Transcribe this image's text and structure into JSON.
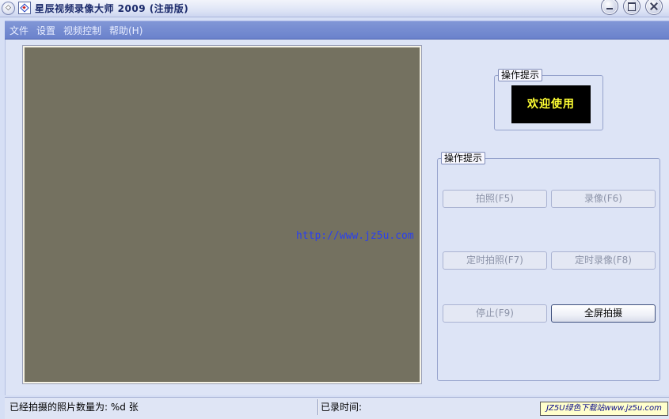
{
  "window": {
    "title": "星辰视频录像大师 2009 (注册版)"
  },
  "menu": {
    "items": [
      "文件",
      "设置",
      "视频控制",
      "帮助(H)"
    ]
  },
  "tips_panel": {
    "legend": "操作提示",
    "message": "欢迎使用"
  },
  "controls_panel": {
    "legend": "操作提示",
    "buttons": {
      "photo": "拍照(F5)",
      "record": "录像(F6)",
      "timed_photo": "定时拍照(F7)",
      "timed_record": "定时录像(F8)",
      "stop": "停止(F9)",
      "fullscreen": "全屏拍摄"
    }
  },
  "watermark": "http://www.jz5u.com",
  "status": {
    "photo_count": "已经拍摄的照片数量为: %d 张",
    "record_time": "已录时间:"
  },
  "badge": "JZ5U绿色下载站www.jz5u.com",
  "colors": {
    "video_bg": "#747160",
    "welcome_bg": "#000000",
    "welcome_text": "#ffff33",
    "menubar": "#7b8fd3",
    "watermark": "#2a3ff0"
  }
}
